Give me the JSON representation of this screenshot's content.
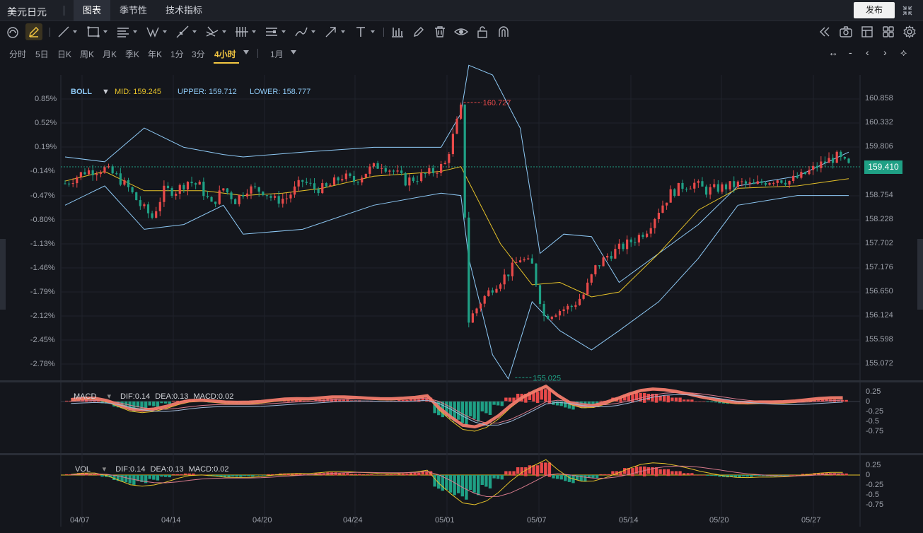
{
  "app": {
    "symbol": "美元日元",
    "tabs": [
      "图表",
      "季节性",
      "技术指标"
    ],
    "publish_label": "发布"
  },
  "periods": [
    "分时",
    "5日",
    "日K",
    "周K",
    "月K",
    "季K",
    "年K",
    "1分",
    "3分",
    "4小时"
  ],
  "active_period": "4小时",
  "range_label": "1月",
  "toolbar_icons": [
    "target-icon",
    "pencil-icon",
    "line-icon",
    "rectangle-icon",
    "horizontal-lines-icon",
    "pattern-icon",
    "ray-icon",
    "crossed-lines-icon",
    "fib-lines-icon",
    "channel-icon",
    "brush-icon",
    "arrow-icon",
    "text-icon",
    "bars-icon",
    "edit-icon",
    "trash-icon",
    "eye-icon",
    "lock-icon",
    "magnet-icon",
    "rewind-icon",
    "camera-icon",
    "layout-icon",
    "list-icon",
    "grid-icon",
    "settings-icon"
  ],
  "nav_controls": [
    "↔",
    "-",
    "‹",
    "›",
    "⟡"
  ],
  "boll": {
    "name": "BOLL",
    "mid": "MID: 159.245",
    "upper": "UPPER: 159.712",
    "lower": "LOWER: 158.777"
  },
  "macd_legend": {
    "name": "MACD",
    "dif": "DIF:0.14",
    "dea": "DEA:0.13",
    "macd": "MACD:0.02"
  },
  "vol_legend": {
    "name": "VOL",
    "dif": "DIF:0.14",
    "dea": "DEA:0.13",
    "macd": "MACD:0.02"
  },
  "last_price": "159.410",
  "high_marker": "160.727",
  "low_marker": "155.025",
  "colors": {
    "up": "#e84a4a",
    "down": "#1fa085",
    "mid": "#e6c229",
    "band": "#8ec9f5",
    "highlight": "#f07a6c",
    "accent": "#f5c842"
  },
  "chart_data": {
    "type": "candlestick",
    "title": "美元日元 4小时",
    "x_ticks": [
      "04/07",
      "04/14",
      "04/20",
      "04/24",
      "05/01",
      "05/07",
      "05/14",
      "05/20",
      "05/27"
    ],
    "y_right_ticks": [
      "160.858",
      "160.332",
      "159.806",
      "158.754",
      "158.228",
      "157.702",
      "157.176",
      "156.650",
      "156.124",
      "155.598",
      "155.072"
    ],
    "y_left_ticks": [
      "0.85%",
      "0.52%",
      "0.19%",
      "-0.14%",
      "-0.47%",
      "-0.80%",
      "-1.13%",
      "-1.46%",
      "-1.79%",
      "-2.12%",
      "-2.45%",
      "-2.78%"
    ],
    "ylim": [
      155.0,
      161.3
    ],
    "mid_y_lim_note": "",
    "close_path": [
      [
        0,
        159.05
      ],
      [
        5,
        159.3
      ],
      [
        10,
        159.35
      ],
      [
        13,
        159.2
      ],
      [
        16,
        158.95
      ],
      [
        19,
        158.6
      ],
      [
        22,
        158.35
      ],
      [
        25,
        158.9
      ],
      [
        28,
        158.9
      ],
      [
        31,
        159.1
      ],
      [
        34,
        159.0
      ],
      [
        37,
        158.6
      ],
      [
        40,
        158.95
      ],
      [
        43,
        158.7
      ],
      [
        46,
        158.95
      ],
      [
        50,
        158.9
      ],
      [
        53,
        158.7
      ],
      [
        56,
        158.75
      ],
      [
        60,
        159.1
      ],
      [
        63,
        158.95
      ],
      [
        66,
        158.95
      ],
      [
        70,
        159.2
      ],
      [
        73,
        159.1
      ],
      [
        77,
        159.35
      ],
      [
        80,
        159.45
      ],
      [
        83,
        159.3
      ],
      [
        86,
        159.1
      ],
      [
        90,
        159.2
      ],
      [
        93,
        159.3
      ],
      [
        96,
        159.45
      ],
      [
        100,
        160.6
      ],
      [
        102,
        156.2
      ],
      [
        105,
        156.6
      ],
      [
        108,
        156.9
      ],
      [
        112,
        157.2
      ],
      [
        115,
        157.5
      ],
      [
        118,
        157.35
      ],
      [
        121,
        156.3
      ],
      [
        124,
        156.4
      ],
      [
        128,
        156.5
      ],
      [
        131,
        156.75
      ],
      [
        134,
        157.3
      ],
      [
        137,
        157.55
      ],
      [
        140,
        157.7
      ],
      [
        144,
        157.9
      ],
      [
        147,
        158.1
      ],
      [
        150,
        158.5
      ],
      [
        153,
        158.85
      ],
      [
        156,
        159.0
      ],
      [
        159,
        159.05
      ],
      [
        162,
        158.9
      ],
      [
        165,
        158.95
      ],
      [
        168,
        159.0
      ],
      [
        171,
        159.05
      ],
      [
        174,
        159.0
      ],
      [
        177,
        159.1
      ],
      [
        180,
        159.15
      ],
      [
        183,
        159.1
      ],
      [
        186,
        159.2
      ],
      [
        189,
        159.35
      ],
      [
        192,
        159.5
      ],
      [
        195,
        159.6
      ],
      [
        198,
        159.41
      ]
    ],
    "volume_note": "",
    "boll_mid": [
      [
        0,
        159.1
      ],
      [
        10,
        159.3
      ],
      [
        20,
        158.9
      ],
      [
        35,
        158.9
      ],
      [
        45,
        158.8
      ],
      [
        55,
        158.85
      ],
      [
        65,
        158.95
      ],
      [
        78,
        159.2
      ],
      [
        95,
        159.3
      ],
      [
        100,
        159.4
      ],
      [
        110,
        157.8
      ],
      [
        118,
        156.95
      ],
      [
        125,
        157.0
      ],
      [
        133,
        156.7
      ],
      [
        140,
        156.8
      ],
      [
        150,
        157.6
      ],
      [
        160,
        158.5
      ],
      [
        170,
        158.95
      ],
      [
        185,
        159.0
      ],
      [
        198,
        159.15
      ]
    ],
    "boll_upper": [
      [
        0,
        159.6
      ],
      [
        10,
        159.5
      ],
      [
        20,
        160.2
      ],
      [
        30,
        159.8
      ],
      [
        40,
        159.65
      ],
      [
        45,
        159.6
      ],
      [
        60,
        159.7
      ],
      [
        78,
        159.8
      ],
      [
        95,
        159.8
      ],
      [
        100,
        160.5
      ],
      [
        102,
        161.5
      ],
      [
        108,
        161.3
      ],
      [
        115,
        160.2
      ],
      [
        120,
        157.6
      ],
      [
        126,
        158.0
      ],
      [
        133,
        157.95
      ],
      [
        140,
        157.0
      ],
      [
        150,
        157.6
      ],
      [
        160,
        158.2
      ],
      [
        170,
        159.0
      ],
      [
        185,
        159.2
      ],
      [
        198,
        159.7
      ]
    ],
    "boll_lower": [
      [
        0,
        158.6
      ],
      [
        10,
        159.0
      ],
      [
        20,
        158.1
      ],
      [
        30,
        158.2
      ],
      [
        40,
        158.6
      ],
      [
        45,
        158.0
      ],
      [
        60,
        158.1
      ],
      [
        78,
        158.6
      ],
      [
        95,
        158.85
      ],
      [
        100,
        158.8
      ],
      [
        102,
        157.5
      ],
      [
        108,
        155.5
      ],
      [
        112,
        155.0
      ],
      [
        118,
        156.6
      ],
      [
        125,
        156.0
      ],
      [
        133,
        155.6
      ],
      [
        140,
        156.0
      ],
      [
        150,
        156.6
      ],
      [
        160,
        157.5
      ],
      [
        170,
        158.6
      ],
      [
        185,
        158.8
      ],
      [
        198,
        158.8
      ]
    ],
    "macd_ticks": [
      "0.25",
      "0",
      "-0.25",
      "-0.5",
      "-0.75"
    ],
    "vol_ticks": [
      "0.25",
      "0",
      "-0.25",
      "-0.5",
      "-0.75"
    ],
    "macd_hist": [
      0.02,
      0.05,
      0.03,
      -0.05,
      -0.15,
      -0.22,
      -0.18,
      -0.12,
      -0.05,
      0.02,
      0.04,
      0.01,
      -0.03,
      -0.05,
      -0.04,
      -0.03,
      -0.01,
      0.02,
      0.04,
      0.03,
      0.02,
      0.05,
      0.07,
      0.05,
      0.03,
      0.02,
      0.01,
      0.02,
      0.04,
      0.06,
      0.1,
      -0.35,
      -0.45,
      -0.55,
      -0.45,
      -0.3,
      -0.1,
      0.1,
      0.2,
      0.25,
      0.32,
      -0.1,
      -0.18,
      -0.15,
      -0.08,
      0.02,
      0.1,
      0.18,
      0.22,
      0.2,
      0.15,
      0.1,
      0.05,
      0.0,
      -0.02,
      -0.05,
      -0.06,
      -0.04,
      -0.02,
      -0.03,
      -0.02,
      0.0,
      0.03,
      0.05,
      0.05,
      0.04
    ]
  }
}
